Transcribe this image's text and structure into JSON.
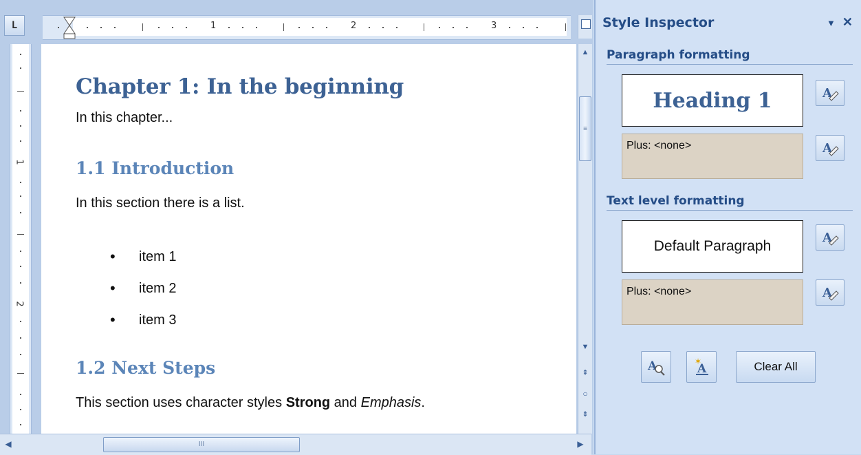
{
  "ruler": {
    "corner_label": "L",
    "h_numbers": [
      "1",
      "2",
      "3"
    ],
    "v_numbers": [
      "1",
      "2"
    ]
  },
  "document": {
    "chapter_heading": "Chapter 1: In the beginning",
    "chapter_intro": "In this chapter...",
    "section1_heading": "1.1 Introduction",
    "section1_text": "In this section there is a list.",
    "list_items": [
      "item 1",
      "item 2",
      "item 3"
    ],
    "section2_heading": "1.2 Next Steps",
    "section2_text_before": "This section uses character styles ",
    "section2_strong": "Strong",
    "section2_and": " and ",
    "section2_emphasis": "Emphasis",
    "section2_end": "."
  },
  "scroll": {
    "thumb_grip": "≡",
    "hthumb_grip": "III"
  },
  "inspector": {
    "title": "Style Inspector",
    "dropdown_glyph": "▼",
    "close_glyph": "✕",
    "paragraph_section": "Paragraph formatting",
    "paragraph_style": "Heading 1",
    "paragraph_plus": "Plus: <none>",
    "text_section": "Text level formatting",
    "text_style": "Default Paragraph",
    "text_plus": "Plus: <none>",
    "clear_all_label": "Clear All"
  },
  "icons": {
    "reset": "reset-style-icon",
    "reveal": "reveal-formatting-icon",
    "new_style": "new-style-icon"
  },
  "colors": {
    "heading1": "#3d6294",
    "heading2": "#5b85b8",
    "pane_title": "#254d87",
    "plus_box": "#dcd3c5"
  }
}
